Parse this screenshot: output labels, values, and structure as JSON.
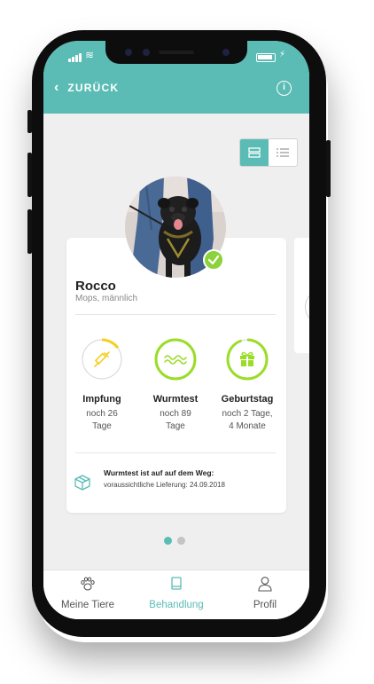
{
  "header": {
    "back_icon": "chevron-left-icon",
    "back_label": "ZURÜCK",
    "info_icon": "info-circle-icon",
    "info_glyph": "i",
    "accent_color": "#5bbcb5"
  },
  "view_toggle": {
    "options": [
      {
        "name": "card-view",
        "icon": "card-layout-icon",
        "active": true
      },
      {
        "name": "list-view",
        "icon": "list-layout-icon",
        "active": false
      }
    ]
  },
  "pet": {
    "name": "Rocco",
    "breed": "Mops, männlich",
    "verified_icon": "check-icon"
  },
  "stats": [
    {
      "title": "Impfung",
      "line1": "noch 26",
      "line2": "Tage",
      "icon": "syringe-icon",
      "progress": 0.15,
      "color": "#f4cf1d"
    },
    {
      "title": "Wurmtest",
      "line1": "noch 89",
      "line2": "Tage",
      "icon": "worm-wave-icon",
      "progress": 1.0,
      "color": "#9bdc28"
    },
    {
      "title": "Geburtstag",
      "line1": "noch 2 Tage,",
      "line2": "4 Monate",
      "icon": "gift-icon",
      "progress": 0.95,
      "color": "#9bdc28"
    }
  ],
  "notice": {
    "icon": "package-box-icon",
    "title": "Wurmtest ist auf auf dem Weg:",
    "text": "voraussichtliche Lieferung: 24.09.2018"
  },
  "pagination": {
    "count": 2,
    "active": 0
  },
  "tabs": [
    {
      "label": "Meine Tiere",
      "icon": "paw-icon",
      "active": false
    },
    {
      "label": "Behandlung",
      "icon": "book-icon",
      "active": true
    },
    {
      "label": "Profil",
      "icon": "user-icon",
      "active": false
    }
  ]
}
